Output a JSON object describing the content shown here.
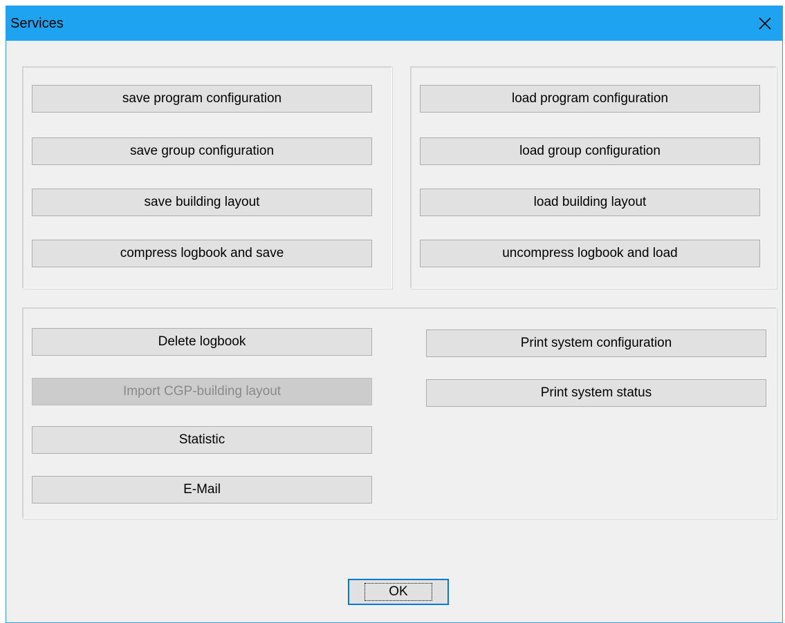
{
  "window": {
    "title": "Services"
  },
  "left_group": {
    "buttons": [
      "save program configuration",
      "save group configuration",
      "save building layout",
      "compress logbook and save"
    ]
  },
  "right_group": {
    "buttons": [
      "load program configuration",
      "load group configuration",
      "load building layout",
      "uncompress logbook and load"
    ]
  },
  "bottom_group": {
    "left_buttons": [
      "Delete logbook",
      "Import CGP-building layout",
      "Statistic",
      "E-Mail"
    ],
    "right_buttons": [
      "Print system configuration",
      "Print system status"
    ]
  },
  "footer": {
    "ok_label": "OK"
  }
}
